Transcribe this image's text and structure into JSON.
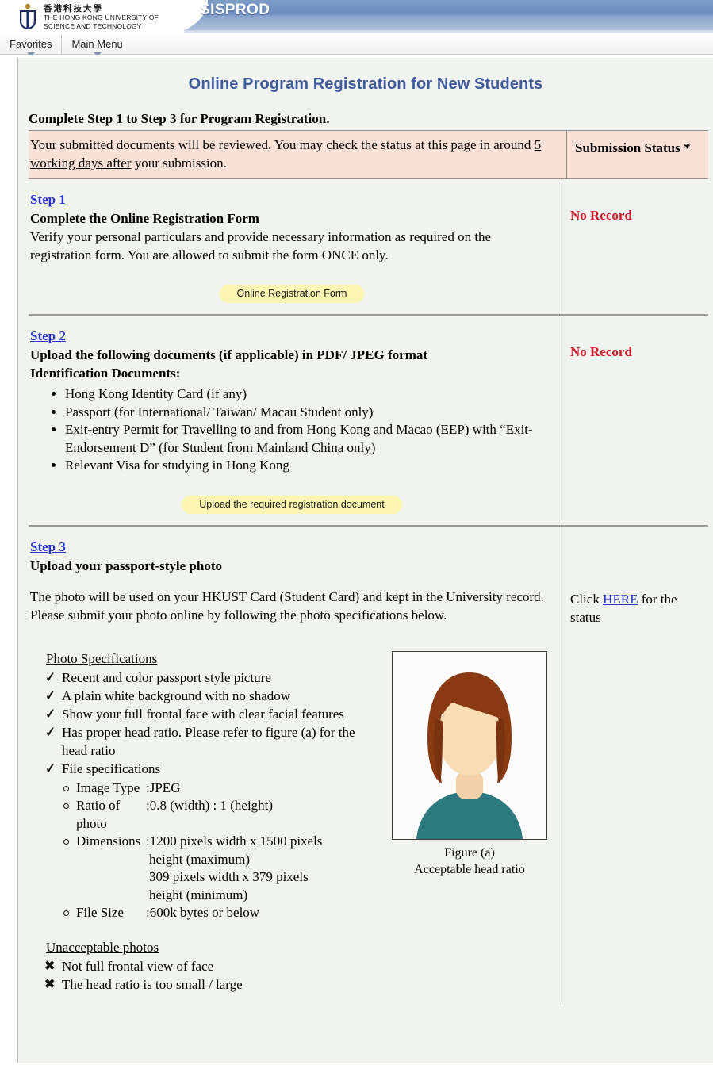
{
  "header": {
    "app_title": "SISPROD",
    "logo_cn": "香港科技大學",
    "logo_en": "THE HONG KONG UNIVERSITY OF\nSCIENCE AND TECHNOLOGY",
    "nav": [
      {
        "label": "Favorites"
      },
      {
        "label": "Main Menu"
      }
    ]
  },
  "page": {
    "title": "Online Program Registration for New Students",
    "intro": "Complete Step 1 to Step 3 for Program Registration.",
    "notice": {
      "text_before": "Your submitted documents will be reviewed. You may check the status at this page in around ",
      "text_underlined": "5 working days after",
      "text_after": " your submission.",
      "status_header": "Submission Status *"
    },
    "steps": [
      {
        "link": "Step 1",
        "heading": "Complete the Online Registration Form",
        "body": "Verify your personal particulars and provide necessary information as required on the registration form. You are allowed to submit the form ONCE only.",
        "button": "Online Registration Form",
        "status": "No Record"
      },
      {
        "link": "Step 2",
        "heading": "Upload the following documents (if applicable) in PDF/ JPEG format",
        "subheading": "Identification Documents:",
        "documents": [
          "Hong Kong Identity Card (if any)",
          "Passport (for International/ Taiwan/ Macau Student only)",
          "Exit-entry Permit for Travelling to and from Hong Kong and Macao (EEP) with “Exit-Endorsement D” (for Student from Mainland China only)",
          "Relevant Visa for studying in Hong Kong"
        ],
        "button": "Upload the required registration document",
        "status": "No Record"
      },
      {
        "link": "Step 3",
        "heading": "Upload your passport-style photo",
        "body": "The photo will be used on your HKUST Card (Student Card) and kept in the University record. Please submit your photo online by following the photo specifications below.",
        "status_prefix": "Click ",
        "status_link": "HERE",
        "status_suffix": " for the status"
      }
    ],
    "photo_spec": {
      "title": "Photo Specifications",
      "items": [
        "Recent and color passport style picture",
        "A plain white background with no shadow",
        "Show your full frontal face with clear facial features",
        "Has proper head ratio. Please refer to figure (a) for the head ratio",
        "File specifications"
      ],
      "file_specs": [
        {
          "key": "Image Type",
          "value": "JPEG",
          "cont": []
        },
        {
          "key": "Ratio of photo",
          "key_line1": "Ratio of",
          "key_line2": "photo",
          "value": "0.8 (width) : 1 (height)",
          "cont": []
        },
        {
          "key": "Dimensions",
          "value": "1200 pixels width x 1500 pixels",
          "cont": [
            "height (maximum)",
            "309 pixels width x 379 pixels",
            "height (minimum)"
          ]
        },
        {
          "key": "File Size",
          "value": "600k bytes or below",
          "cont": []
        }
      ],
      "figure_caption_line1": "Figure (a)",
      "figure_caption_line2": "Acceptable head ratio"
    },
    "unacceptable": {
      "title": "Unacceptable photos",
      "items": [
        "Not full frontal view of face",
        "The head ratio is too small / large"
      ]
    },
    "colors": {
      "banner_blue": "#6e8dbe",
      "title_blue": "#3d5a9c",
      "link_blue": "#2b36c8",
      "status_red": "#d01a2b",
      "notice_pink": "#fae1d7",
      "button_yellow": "#fbf6b2",
      "content_bg": "#f1f3ee"
    }
  }
}
